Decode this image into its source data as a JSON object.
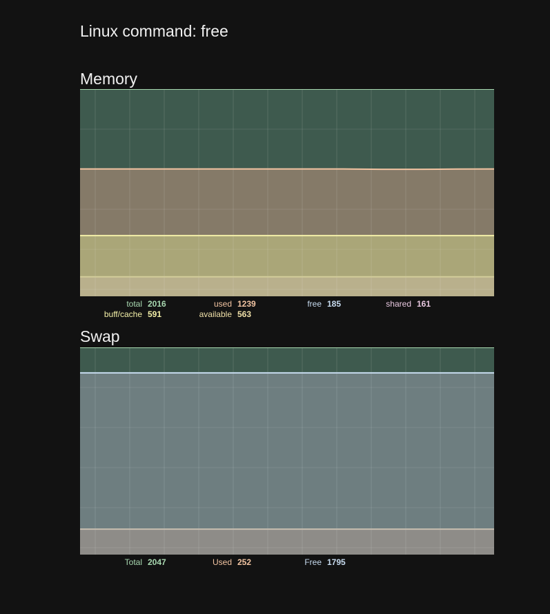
{
  "page_title": "Linux command: free",
  "memory": {
    "title": "Memory",
    "legend": [
      {
        "label": "total",
        "value": "2016",
        "color": "#a8d8b0"
      },
      {
        "label": "used",
        "value": "1239",
        "color": "#f2c4a2"
      },
      {
        "label": "free",
        "value": "185",
        "color": "#c8dcf0"
      },
      {
        "label": "shared",
        "value": "161",
        "color": "#e8c8e0"
      },
      {
        "label": "buff/cache",
        "value": "591",
        "color": "#f4f0a8"
      },
      {
        "label": "available",
        "value": "563",
        "color": "#f0e0a8"
      }
    ]
  },
  "swap": {
    "title": "Swap",
    "legend": [
      {
        "label": "Total",
        "value": "2047",
        "color": "#a8d8b0"
      },
      {
        "label": "Used",
        "value": "252",
        "color": "#f2c4a2"
      },
      {
        "label": "Free",
        "value": "1795",
        "color": "#c8dcf0"
      }
    ]
  },
  "chart_data": [
    {
      "type": "area",
      "title": "Memory",
      "ylim": [
        0,
        2016
      ],
      "grid": true,
      "series": [
        {
          "name": "total",
          "color": "#3e5a4e",
          "line": "#a8d8b0",
          "values": [
            2016,
            2016,
            2016,
            2016,
            2016,
            2016,
            2016,
            2016,
            2016,
            2016,
            2016,
            2016
          ]
        },
        {
          "name": "used",
          "color": "#857a68",
          "line": "#f2c4a2",
          "values": [
            1239,
            1239,
            1239,
            1239,
            1239,
            1239,
            1239,
            1239,
            1236,
            1236,
            1238,
            1239
          ]
        },
        {
          "name": "buff/cache",
          "color": "#aaa678",
          "line": "#f4f0a8",
          "values": [
            591,
            591,
            591,
            591,
            591,
            591,
            591,
            591,
            591,
            591,
            591,
            591
          ]
        },
        {
          "name": "available",
          "color": "#b9b08c",
          "line": "#d2cc9a",
          "values": [
            190,
            190,
            190,
            190,
            190,
            190,
            190,
            190,
            190,
            190,
            190,
            190
          ]
        }
      ]
    },
    {
      "type": "area",
      "title": "Swap",
      "ylim": [
        0,
        2047
      ],
      "grid": true,
      "series": [
        {
          "name": "Total",
          "color": "#3e5a4e",
          "line": "#a8d8b0",
          "values": [
            2047,
            2047,
            2047,
            2047,
            2047,
            2047,
            2047,
            2047,
            2047,
            2047,
            2047,
            2047
          ]
        },
        {
          "name": "Free",
          "color": "#6e7e80",
          "line": "#c8dcf0",
          "values": [
            1795,
            1795,
            1795,
            1795,
            1795,
            1795,
            1795,
            1795,
            1795,
            1795,
            1795,
            1795
          ]
        },
        {
          "name": "Used",
          "color": "#8e8c88",
          "line": "#c8beb0",
          "values": [
            252,
            252,
            252,
            252,
            252,
            252,
            252,
            252,
            252,
            252,
            252,
            252
          ]
        }
      ]
    }
  ]
}
